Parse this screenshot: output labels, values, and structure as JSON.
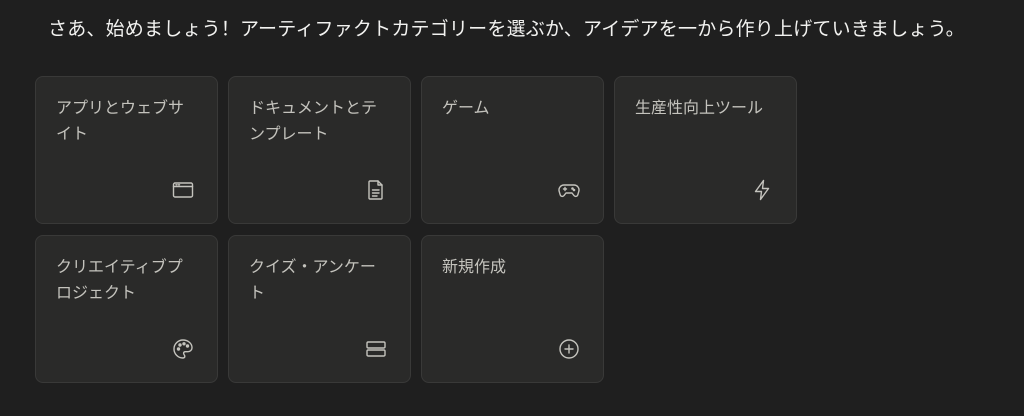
{
  "intro": {
    "text": "さあ、始めましょう！アーティファクトカテゴリーを選ぶか、アイデアを一から作り上げていきましょう。"
  },
  "categories": [
    {
      "label": "アプリとウェブサイト",
      "icon": "browser-window-icon"
    },
    {
      "label": "ドキュメントとテンプレート",
      "icon": "document-icon"
    },
    {
      "label": "ゲーム",
      "icon": "gamepad-icon"
    },
    {
      "label": "生産性向上ツール",
      "icon": "lightning-icon"
    },
    {
      "label": "クリエイティブプロジェクト",
      "icon": "palette-icon"
    },
    {
      "label": "クイズ・アンケート",
      "icon": "stacked-rows-icon"
    },
    {
      "label": "新規作成",
      "icon": "plus-circle-icon"
    }
  ]
}
